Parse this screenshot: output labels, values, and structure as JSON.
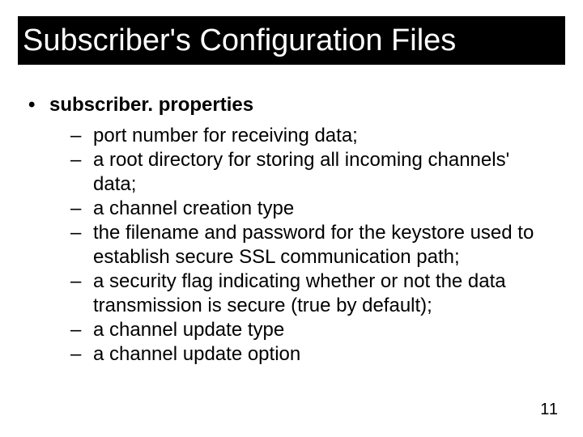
{
  "title": "Subscriber's Configuration Files",
  "topic": {
    "label": "subscriber. properties",
    "items": [
      "port number for receiving data;",
      "a root directory for storing all incoming channels' data;",
      "a channel creation type",
      "the filename and password for the keystore used to establish secure SSL communication path;",
      "a security flag indicating  whether or not the data transmission is secure (true by default);",
      "a channel update type",
      "a channel update option"
    ]
  },
  "page_number": "11"
}
